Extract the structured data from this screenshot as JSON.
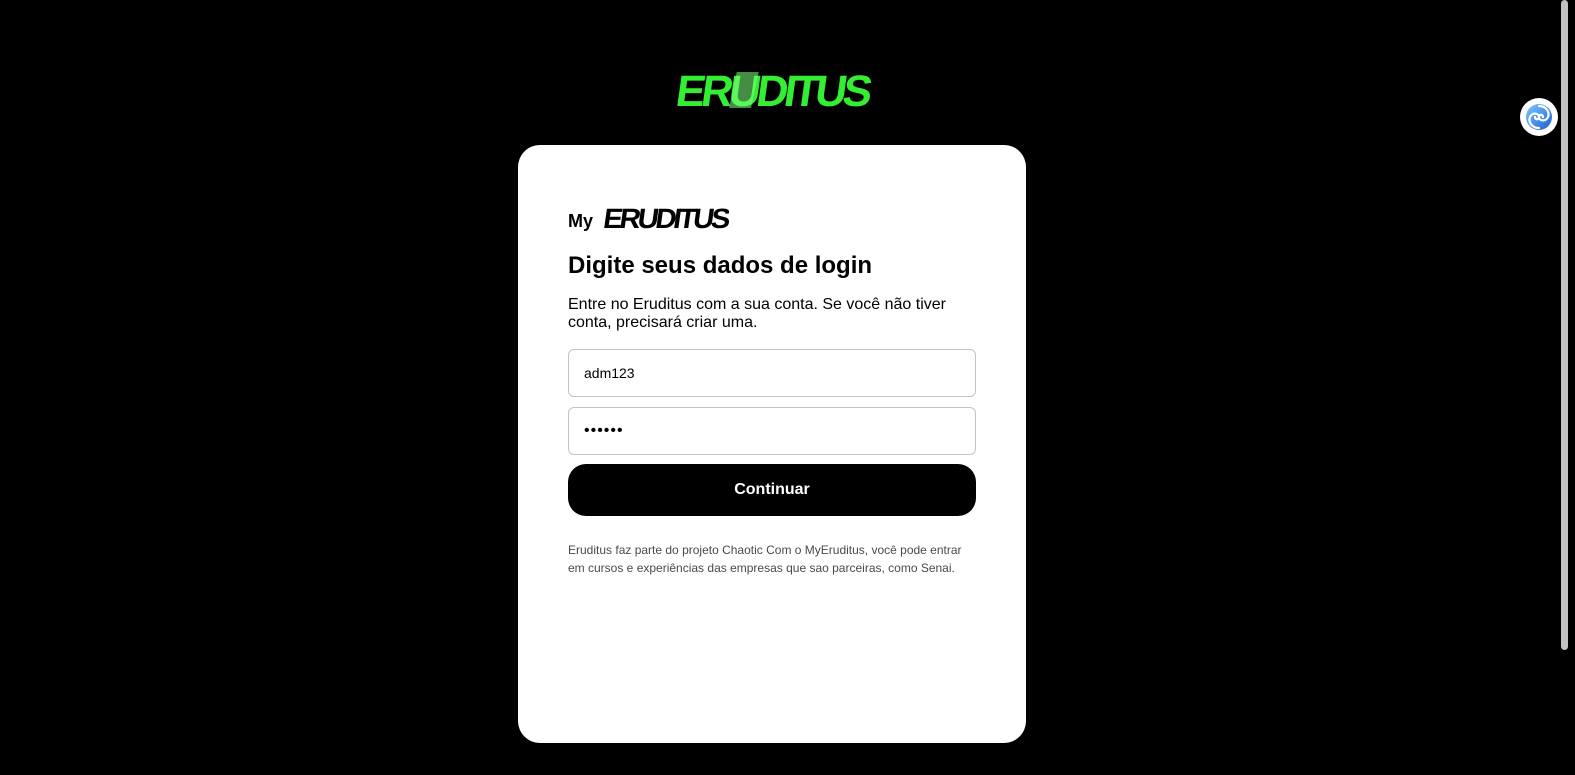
{
  "header": {
    "logo_text": "ERUDITUS",
    "logo_color": "#33ee33"
  },
  "card": {
    "brand_prefix": "My",
    "brand_logo_text": "ERUDITUS",
    "title": "Digite seus dados de login",
    "description": "Entre no Eruditus com a sua conta. Se você não tiver conta, precisará criar uma.",
    "username_value": "adm123",
    "password_value": "••••••",
    "continue_label": "Continuar",
    "footnote": "Eruditus faz parte do projeto Chaotic Com o MyEruditus, você pode entrar em cursos e experiências das empresas que sao parceiras, como Senai."
  },
  "extension": {
    "icon": "swirl-extension-icon"
  }
}
